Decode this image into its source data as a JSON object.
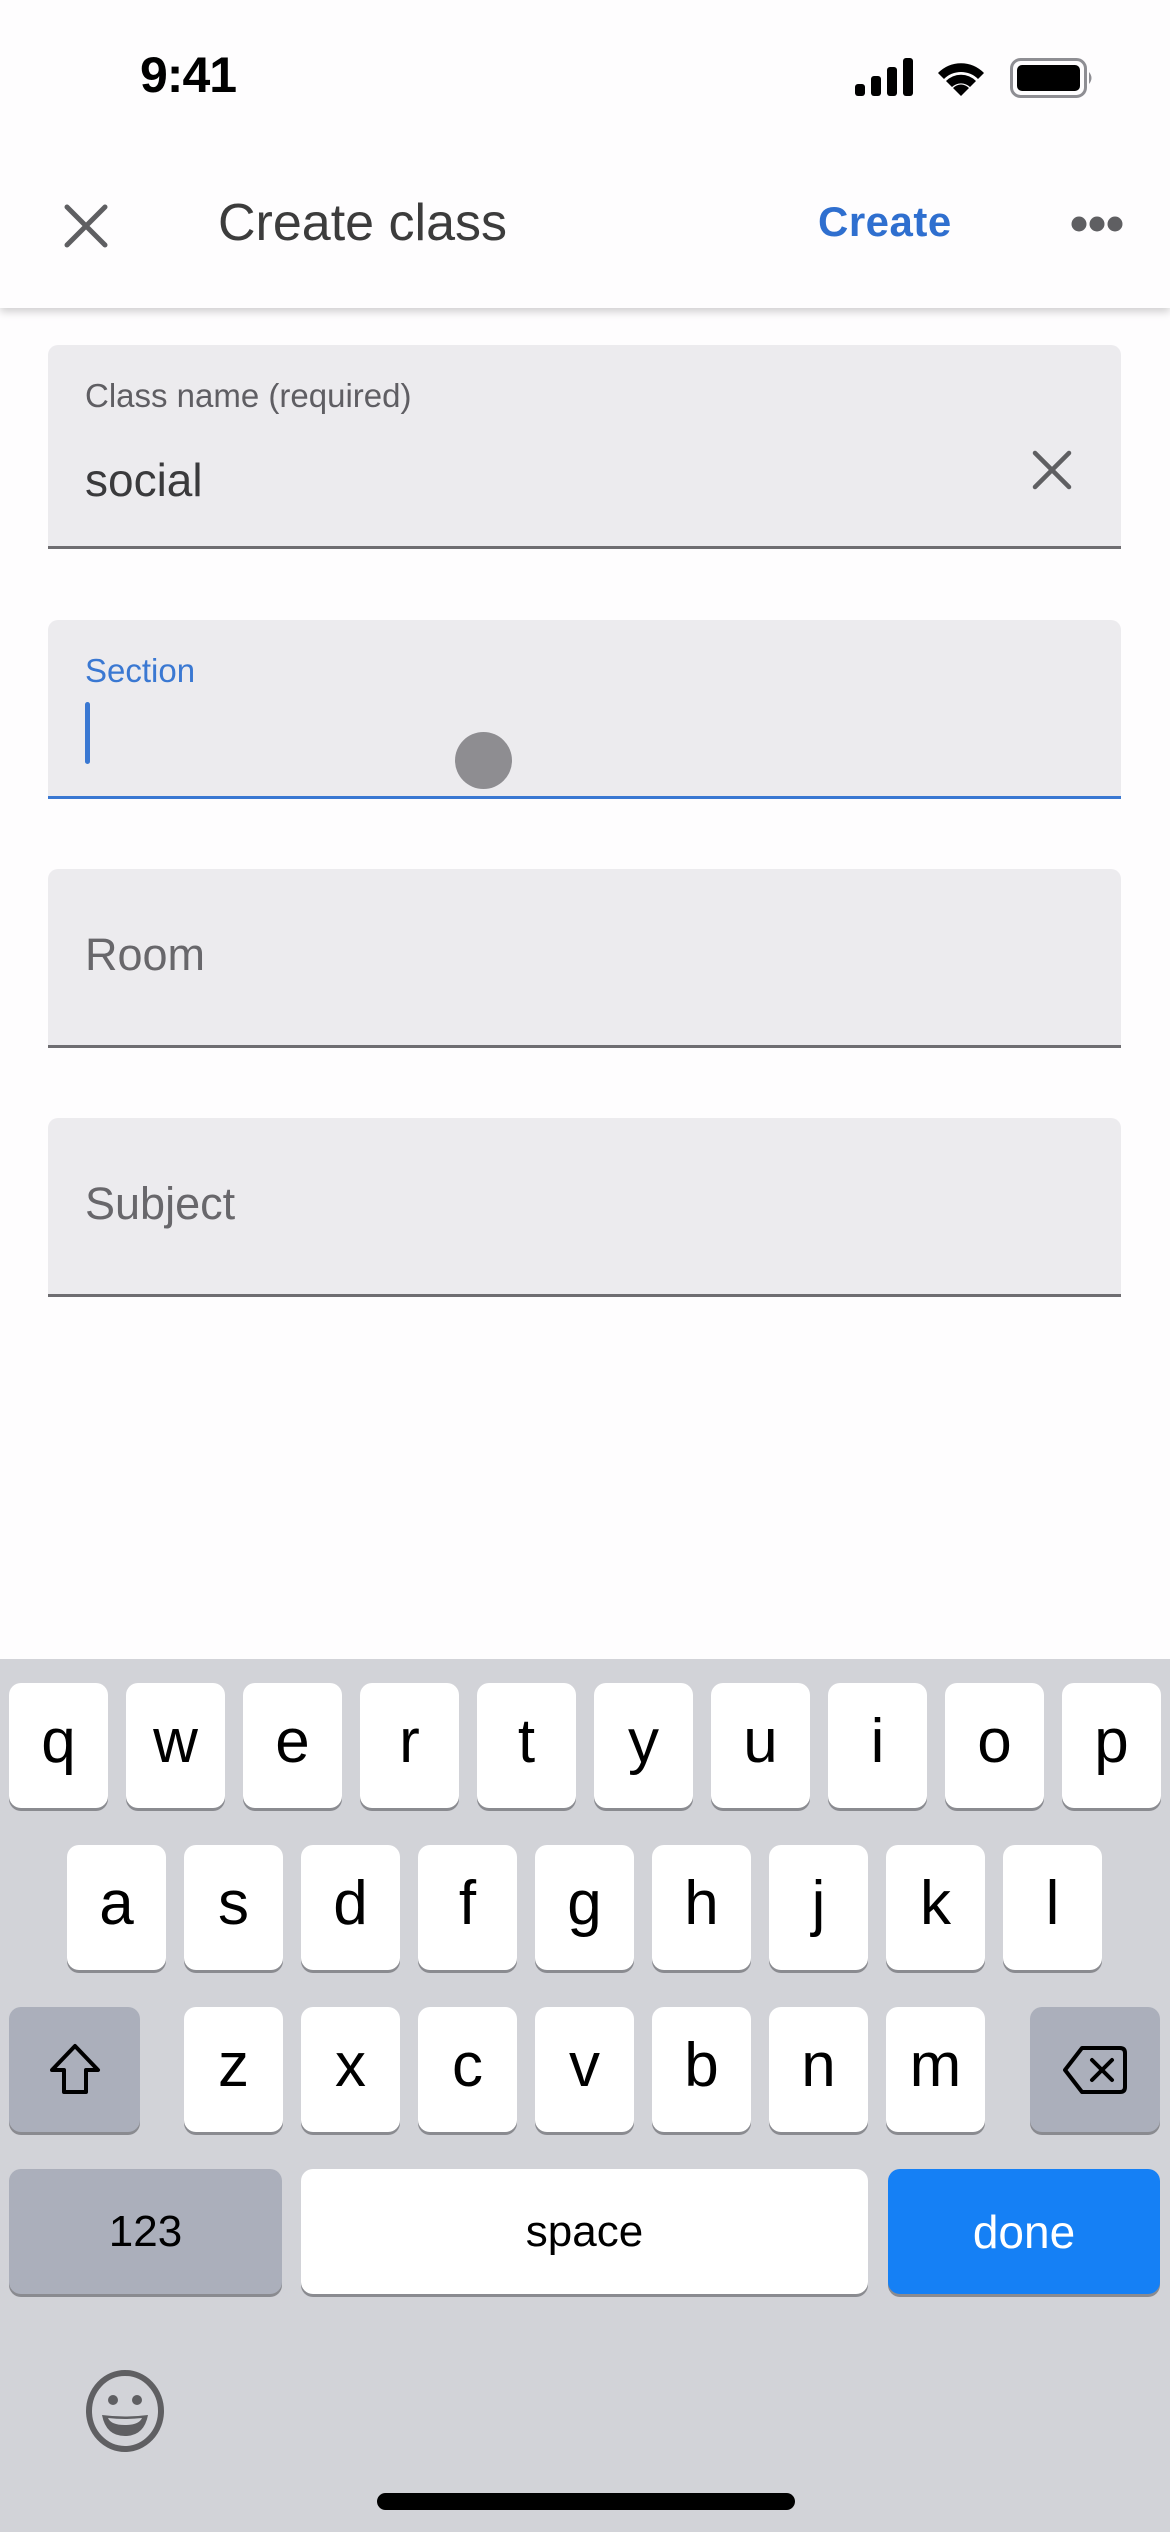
{
  "status_bar": {
    "time": "9:41",
    "icons": [
      "cellular-signal-icon",
      "wifi-icon",
      "battery-icon"
    ]
  },
  "header": {
    "close_icon": "close-icon",
    "title": "Create class",
    "create_label": "Create",
    "more_icon": "more-horizontal-icon"
  },
  "colors": {
    "accent": "#2f6fcf",
    "focus": "#3a78d2",
    "field_bg": "#ecebee",
    "done_key": "#1580f5"
  },
  "form": {
    "class_name": {
      "label": "Class name (required)",
      "value": "social",
      "clear_icon": "clear-icon"
    },
    "section": {
      "label": "Section",
      "value": "",
      "focused": true
    },
    "room": {
      "placeholder": "Room",
      "value": ""
    },
    "subject": {
      "placeholder": "Subject",
      "value": ""
    }
  },
  "keyboard": {
    "row1": [
      "q",
      "w",
      "e",
      "r",
      "t",
      "y",
      "u",
      "i",
      "o",
      "p"
    ],
    "row2": [
      "a",
      "s",
      "d",
      "f",
      "g",
      "h",
      "j",
      "k",
      "l"
    ],
    "row3": [
      "z",
      "x",
      "c",
      "v",
      "b",
      "n",
      "m"
    ],
    "shift_icon": "shift-icon",
    "backspace_icon": "backspace-icon",
    "numbers_label": "123",
    "space_label": "space",
    "done_label": "done",
    "emoji_icon": "emoji-icon"
  }
}
